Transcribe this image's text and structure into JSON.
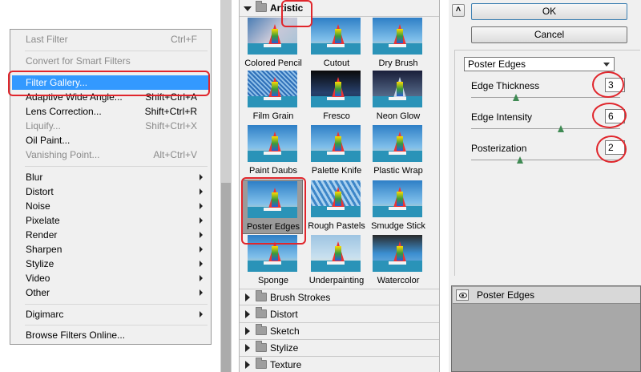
{
  "menu": {
    "items": [
      {
        "label": "Last Filter",
        "shortcut": "Ctrl+F",
        "disabled": true
      },
      {
        "label": "Convert for Smart Filters",
        "shortcut": "",
        "disabled": true
      },
      {
        "label": "Filter Gallery...",
        "shortcut": "",
        "selected": true
      },
      {
        "label": "Adaptive Wide Angle...",
        "shortcut": "Shift+Ctrl+A"
      },
      {
        "label": "Lens Correction...",
        "shortcut": "Shift+Ctrl+R"
      },
      {
        "label": "Liquify...",
        "shortcut": "Shift+Ctrl+X",
        "disabled": true
      },
      {
        "label": "Oil Paint...",
        "shortcut": ""
      },
      {
        "label": "Vanishing Point...",
        "shortcut": "Alt+Ctrl+V",
        "disabled": true
      },
      {
        "label": "Blur",
        "submenu": true
      },
      {
        "label": "Distort",
        "submenu": true
      },
      {
        "label": "Noise",
        "submenu": true
      },
      {
        "label": "Pixelate",
        "submenu": true
      },
      {
        "label": "Render",
        "submenu": true
      },
      {
        "label": "Sharpen",
        "submenu": true
      },
      {
        "label": "Stylize",
        "submenu": true
      },
      {
        "label": "Video",
        "submenu": true
      },
      {
        "label": "Other",
        "submenu": true
      },
      {
        "label": "Digimarc",
        "submenu": true
      },
      {
        "label": "Browse Filters Online..."
      }
    ]
  },
  "gallery": {
    "open_category": "Artistic",
    "thumbnails": [
      {
        "label": "Colored Pencil"
      },
      {
        "label": "Cutout"
      },
      {
        "label": "Dry Brush"
      },
      {
        "label": "Film Grain"
      },
      {
        "label": "Fresco"
      },
      {
        "label": "Neon Glow"
      },
      {
        "label": "Paint Daubs"
      },
      {
        "label": "Palette Knife"
      },
      {
        "label": "Plastic Wrap"
      },
      {
        "label": "Poster Edges",
        "active": true
      },
      {
        "label": "Rough Pastels"
      },
      {
        "label": "Smudge Stick"
      },
      {
        "label": "Sponge"
      },
      {
        "label": "Underpainting"
      },
      {
        "label": "Watercolor"
      }
    ],
    "closed_categories": [
      "Brush Strokes",
      "Distort",
      "Sketch",
      "Stylize",
      "Texture"
    ]
  },
  "settings": {
    "ok_label": "OK",
    "cancel_label": "Cancel",
    "filter_select": "Poster Edges",
    "params": [
      {
        "label": "Edge Thickness",
        "value": "3",
        "fraction": 0.3
      },
      {
        "label": "Edge Intensity",
        "value": "6",
        "fraction": 0.6
      },
      {
        "label": "Posterization",
        "value": "2",
        "fraction": 0.33
      }
    ],
    "layer_name": "Poster Edges"
  },
  "colors": {
    "selection": "#3399ff",
    "annotation": "#e0262c",
    "slider_thumb": "#3f8a53"
  }
}
